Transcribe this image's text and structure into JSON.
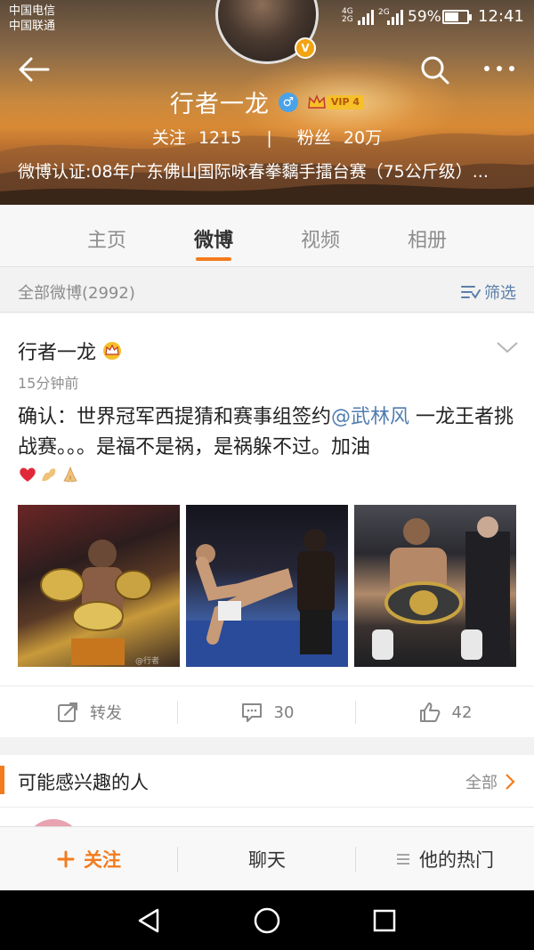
{
  "status_bar": {
    "carrier1": "中国电信",
    "carrier2": "中国联通",
    "network1": "4G",
    "network1b": "2G",
    "network2": "2G",
    "battery": "59%",
    "time": "12:41"
  },
  "profile": {
    "name": "行者一龙",
    "vip_label": "VIP 4",
    "following_label": "关注",
    "following_count": "1215",
    "separator": "|",
    "fans_label": "粉丝",
    "fans_count": "20万",
    "verification": "微博认证:08年广东佛山国际咏春拳黐手擂台赛（75公斤级）..."
  },
  "tabs": [
    {
      "label": "主页"
    },
    {
      "label": "微博"
    },
    {
      "label": "视频"
    },
    {
      "label": "相册"
    }
  ],
  "active_tab": "微博",
  "filter_bar": {
    "all_label": "全部微博(2992)",
    "filter_label": "筛选"
  },
  "post": {
    "author": "行者一龙",
    "time": "15分钟前",
    "text_before": "确认：世界冠军西提猜和赛事组签约",
    "mention": "@武林风",
    "text_after": " 一龙王者挑战赛。。。是福不是祸，是祸躲不过。加油",
    "image_watermark": "@行者",
    "images": [
      "champion-belts-photo",
      "kick-fight-photo",
      "belt-ceremony-photo"
    ],
    "repost_label": "转发",
    "comment_count": "30",
    "like_count": "42"
  },
  "interest": {
    "title": "可能感兴趣的人",
    "all_label": "全部"
  },
  "bottom_bar": {
    "follow_label": "关注",
    "chat_label": "聊天",
    "hot_label": "他的热门"
  },
  "colors": {
    "accent": "#f37b1d",
    "link": "#507daf",
    "vip": "#f6c028"
  }
}
